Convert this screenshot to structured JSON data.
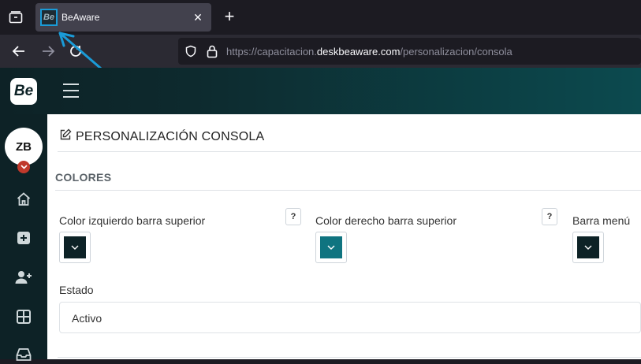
{
  "browser": {
    "tab": {
      "favicon_text": "Be",
      "title": "BeAware"
    },
    "url": {
      "prefix": "https://capacitacion.",
      "domain": "deskbeaware.com",
      "path": "/personalizacion/consola"
    }
  },
  "app": {
    "logo_text": "Be",
    "user_initials": "ZB"
  },
  "page": {
    "title": "PERSONALIZACIÓN CONSOLA",
    "section_title": "COLORES",
    "fields": {
      "left_color": {
        "label": "Color izquierdo barra superior",
        "help": "?",
        "color": "#0d2226"
      },
      "right_color": {
        "label": "Color derecho barra superior",
        "help": "?",
        "color": "#0f7480"
      },
      "menu_color": {
        "label": "Barra menú",
        "color": "#0d2226"
      }
    },
    "estado": {
      "label": "Estado",
      "value": "Activo"
    }
  },
  "colors": {
    "accent_annotation": "#1a9bd7",
    "header_gradient_start": "#0d2226",
    "header_gradient_end": "#0c4a4f"
  }
}
